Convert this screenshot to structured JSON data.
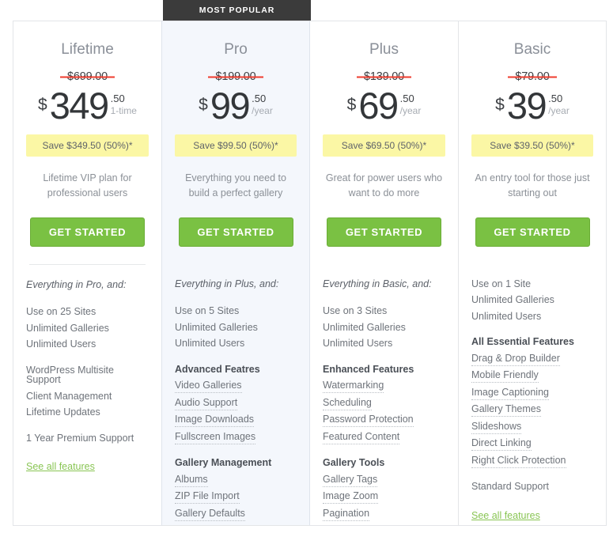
{
  "ribbon": {
    "label": "MOST POPULAR"
  },
  "plans": [
    {
      "id": "lifetime",
      "name": "Lifetime",
      "featured": false,
      "old_price": "$699.00",
      "currency": "$",
      "amount": "349",
      "cents": ".50",
      "period": "1-time",
      "save_badge": "Save $349.50 (50%)*",
      "tagline": "Lifetime VIP plan for professional users",
      "cta_label": "GET STARTED",
      "features": [
        {
          "type": "intro",
          "label": "Everything in Pro, and:"
        },
        {
          "type": "plain",
          "label": "Use on 25 Sites"
        },
        {
          "type": "plain",
          "label": "Unlimited Galleries"
        },
        {
          "type": "plain",
          "label": "Unlimited Users"
        },
        {
          "type": "gap",
          "label": ""
        },
        {
          "type": "plain",
          "label": "WordPress Multisite Support"
        },
        {
          "type": "plain",
          "label": "Client Management"
        },
        {
          "type": "plain",
          "label": "Lifetime Updates"
        },
        {
          "type": "gap",
          "label": ""
        },
        {
          "type": "plain",
          "label": "1 Year Premium Support"
        },
        {
          "type": "gap",
          "label": ""
        },
        {
          "type": "see-all",
          "label": "See all features"
        }
      ]
    },
    {
      "id": "pro",
      "name": "Pro",
      "featured": true,
      "old_price": "$199.00",
      "currency": "$",
      "amount": "99",
      "cents": ".50",
      "period": "/year",
      "save_badge": "Save $99.50 (50%)*",
      "tagline": "Everything you need to build a perfect gallery",
      "cta_label": "GET STARTED",
      "features": [
        {
          "type": "intro",
          "label": "Everything in Plus, and:"
        },
        {
          "type": "plain",
          "label": "Use on 5 Sites"
        },
        {
          "type": "plain",
          "label": "Unlimited Galleries"
        },
        {
          "type": "plain",
          "label": "Unlimited Users"
        },
        {
          "type": "gap",
          "label": ""
        },
        {
          "type": "heading",
          "label": "Advanced Featres"
        },
        {
          "type": "tip",
          "label": "Video Galleries"
        },
        {
          "type": "tip",
          "label": "Audio Support"
        },
        {
          "type": "tip",
          "label": "Image Downloads"
        },
        {
          "type": "tip",
          "label": "Fullscreen Images"
        },
        {
          "type": "gap",
          "label": ""
        },
        {
          "type": "heading",
          "label": "Gallery Management"
        },
        {
          "type": "tip",
          "label": "Albums"
        },
        {
          "type": "tip",
          "label": "ZIP File Import"
        },
        {
          "type": "tip",
          "label": "Gallery Defaults"
        }
      ]
    },
    {
      "id": "plus",
      "name": "Plus",
      "featured": false,
      "old_price": "$139.00",
      "currency": "$",
      "amount": "69",
      "cents": ".50",
      "period": "/year",
      "save_badge": "Save $69.50 (50%)*",
      "tagline": "Great for power users who want to do more",
      "cta_label": "GET STARTED",
      "features": [
        {
          "type": "intro",
          "label": "Everything in Basic, and:"
        },
        {
          "type": "plain",
          "label": "Use on 3 Sites"
        },
        {
          "type": "plain",
          "label": "Unlimited Galleries"
        },
        {
          "type": "plain",
          "label": "Unlimited Users"
        },
        {
          "type": "gap",
          "label": ""
        },
        {
          "type": "heading",
          "label": "Enhanced Features"
        },
        {
          "type": "tip",
          "label": "Watermarking"
        },
        {
          "type": "tip",
          "label": "Scheduling"
        },
        {
          "type": "tip",
          "label": "Password Protection"
        },
        {
          "type": "tip",
          "label": "Featured Content"
        },
        {
          "type": "gap",
          "label": ""
        },
        {
          "type": "heading",
          "label": "Gallery Tools"
        },
        {
          "type": "tip",
          "label": "Gallery Tags"
        },
        {
          "type": "tip",
          "label": "Image Zoom"
        },
        {
          "type": "tip",
          "label": "Pagination"
        }
      ]
    },
    {
      "id": "basic",
      "name": "Basic",
      "featured": false,
      "old_price": "$79.00",
      "currency": "$",
      "amount": "39",
      "cents": ".50",
      "period": "/year",
      "save_badge": "Save $39.50 (50%)*",
      "tagline": "An entry tool for those just starting out",
      "cta_label": "GET STARTED",
      "features": [
        {
          "type": "plain",
          "label": "Use on 1 Site"
        },
        {
          "type": "plain",
          "label": "Unlimited Galleries"
        },
        {
          "type": "plain",
          "label": "Unlimited Users"
        },
        {
          "type": "gap",
          "label": ""
        },
        {
          "type": "heading",
          "label": "All Essential Features"
        },
        {
          "type": "tip",
          "label": "Drag & Drop Builder"
        },
        {
          "type": "tip",
          "label": "Mobile Friendly"
        },
        {
          "type": "tip",
          "label": "Image Captioning"
        },
        {
          "type": "tip",
          "label": "Gallery Themes"
        },
        {
          "type": "tip",
          "label": "Slideshows"
        },
        {
          "type": "tip",
          "label": "Direct Linking"
        },
        {
          "type": "tip",
          "label": "Right Click Protection"
        },
        {
          "type": "gap",
          "label": ""
        },
        {
          "type": "plain",
          "label": "Standard Support"
        },
        {
          "type": "gap",
          "label": ""
        },
        {
          "type": "see-all",
          "label": "See all features"
        }
      ]
    }
  ],
  "colors": {
    "cta_green": "#7ac143",
    "link_green": "#89c554",
    "save_yellow": "#fbf7a5",
    "strike_red": "#ef3b2d",
    "ribbon_dark": "#3b3b3b",
    "featured_bg": "#f4f7fc"
  }
}
